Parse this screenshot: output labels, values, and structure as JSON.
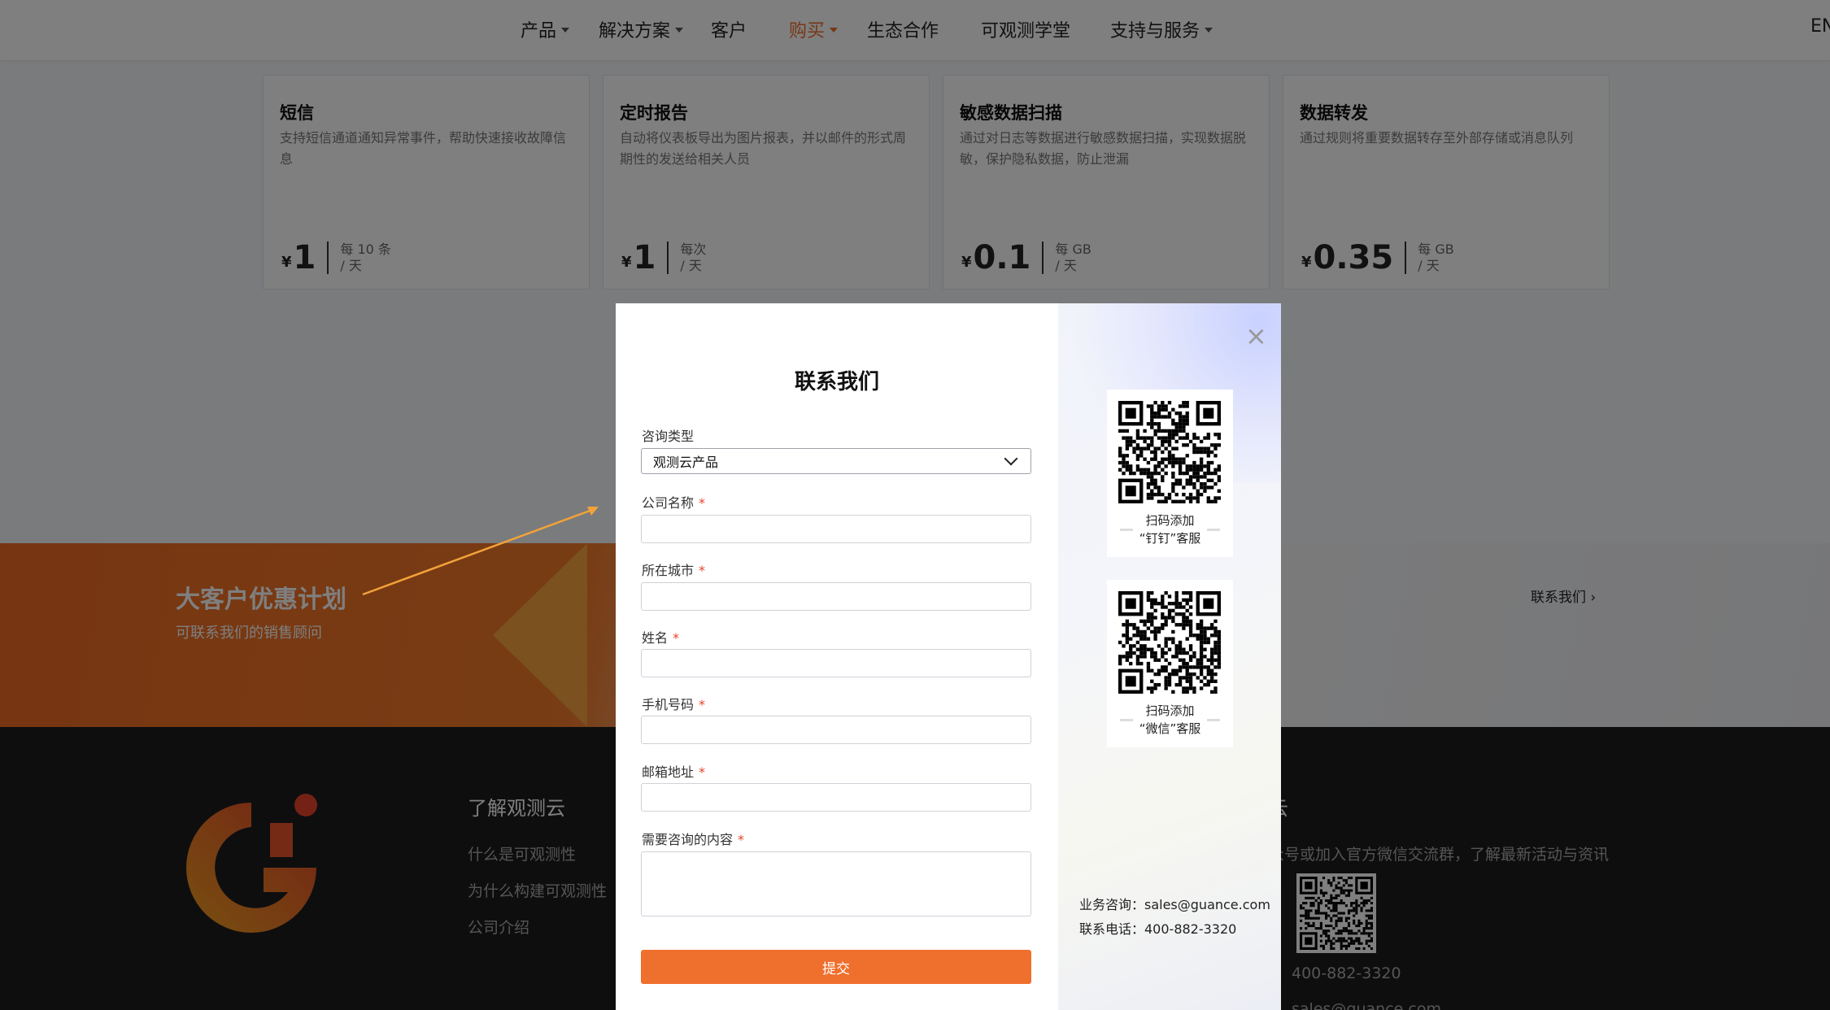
{
  "nav": {
    "items": [
      {
        "label": "产品",
        "dropdown": true
      },
      {
        "label": "解决方案",
        "dropdown": true
      },
      {
        "label": "客户",
        "dropdown": false
      },
      {
        "label": "购买",
        "dropdown": true,
        "active": true
      },
      {
        "label": "生态合作",
        "dropdown": false
      },
      {
        "label": "可观测学堂",
        "dropdown": false
      },
      {
        "label": "支持与服务",
        "dropdown": true
      }
    ],
    "lang": "EN",
    "active_color": "#ec6d2c"
  },
  "pricing": [
    {
      "title": "短信",
      "desc": "支持短信通道通知异常事件，帮助快速接收故障信息",
      "currency": "¥",
      "price": "1",
      "unit1": "每 10 条",
      "unit2": "/ 天"
    },
    {
      "title": "定时报告",
      "desc": "自动将仪表板导出为图片报表，并以邮件的形式周期性的发送给相关人员",
      "currency": "¥",
      "price": "1",
      "unit1": "每次",
      "unit2": "/ 天"
    },
    {
      "title": "敏感数据扫描",
      "desc": "通过对日志等数据进行敏感数据扫描，实现数据脱敏，保护隐私数据，防止泄漏",
      "currency": "¥",
      "price": "0.1",
      "unit1": "每 GB",
      "unit2": "/ 天"
    },
    {
      "title": "数据转发",
      "desc": "通过规则将重要数据转存至外部存储或消息队列",
      "currency": "¥",
      "price": "0.35",
      "unit1": "每 GB",
      "unit2": "/ 天"
    }
  ],
  "promo": {
    "title": "大客户优惠计划",
    "subtitle": "可联系我们的销售顾问",
    "link": "联系我们 ›"
  },
  "footer": {
    "heading": "了解观测云",
    "links": [
      "什么是可观测性",
      "为什么构建可观测性",
      "公司介绍"
    ],
    "right_heading": "云",
    "right_text": "众号或加入官方微信交流群，了解最新活动与资讯",
    "phone": "400-882-3320",
    "email": "sales@guance.com"
  },
  "modal": {
    "title": "联系我们",
    "fields": {
      "type_label": "咨询类型",
      "type_value": "观测云产品",
      "company_label": "公司名称",
      "city_label": "所在城市",
      "name_label": "姓名",
      "phone_label": "手机号码",
      "email_label": "邮箱地址",
      "content_label": "需要咨询的内容",
      "required_mark": "*"
    },
    "submit_label": "提交",
    "close_glyph": "×",
    "qr_dingtalk": {
      "line1": "扫码添加",
      "line2": "“钉钉”客服"
    },
    "qr_wechat": {
      "line1": "扫码添加",
      "line2": "“微信”客服"
    },
    "contact_sales": "业务咨询：sales@guance.com",
    "contact_phone": "联系电话：400-882-3320",
    "accent_color": "#ef6f2d"
  }
}
